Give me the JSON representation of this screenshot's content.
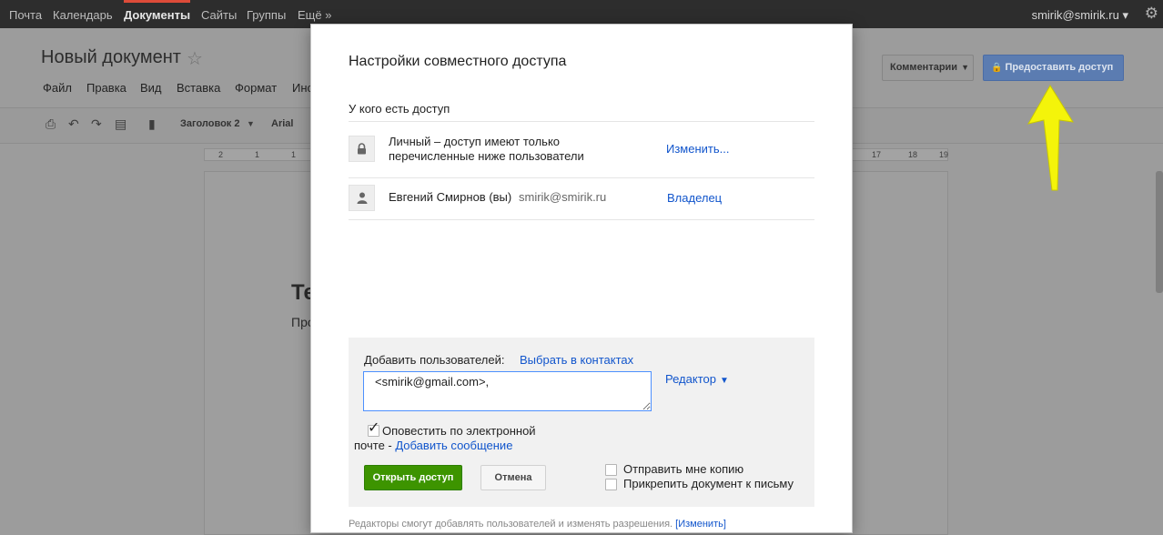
{
  "topbar": {
    "nav_items": [
      "Почта",
      "Календарь",
      "Документы",
      "Сайты",
      "Группы",
      "Ещё »"
    ],
    "account": "smirik@smirik.ru",
    "account_caret": "▾",
    "gear_icon": "gear-icon"
  },
  "document": {
    "title": "Новый документ",
    "menu": [
      "Файл",
      "Правка",
      "Вид",
      "Вставка",
      "Формат",
      "Инс"
    ],
    "comments_button": "Комментарии",
    "share_button": "Предоставить доступ",
    "toolbar_style": "Заголовок 2",
    "toolbar_font": "Arial",
    "ruler_numbers": [
      "2",
      "1",
      "1",
      "17",
      "18",
      "19"
    ],
    "heading_partial": "Те",
    "text_partial": "Про"
  },
  "dialog": {
    "title": "Настройки совместного доступа",
    "access_heading": "У кого есть доступ",
    "privacy_line1": "Личный – доступ имеют только",
    "privacy_line2": "перечисленные ниже пользователи",
    "change_link": "Изменить...",
    "owner_name": "Евгений Смирнов (вы)",
    "owner_email": "smirik@smirik.ru",
    "owner_role": "Владелец",
    "add_users_label": "Добавить пользователей:",
    "choose_contacts": "Выбрать в контактах",
    "input_value": "<smirik@gmail.com>,",
    "role_value": "Редактор",
    "notify_line1": "Оповестить по электронной",
    "notify_line2": "почте - ",
    "add_message_link": "Добавить сообщение",
    "notify_checked": true,
    "open_access_button": "Открыть доступ",
    "cancel_button": "Отмена",
    "send_copy": "Отправить мне копию",
    "attach_doc": "Прикрепить документ к письму",
    "footer_text": "Редакторы смогут добавлять пользователей и изменять разрешения.",
    "footer_link": "[Изменить]"
  },
  "colors": {
    "accent_blue": "#1155cc",
    "open_button": "#3d9400",
    "annotation_arrow": "#f4f40a"
  }
}
